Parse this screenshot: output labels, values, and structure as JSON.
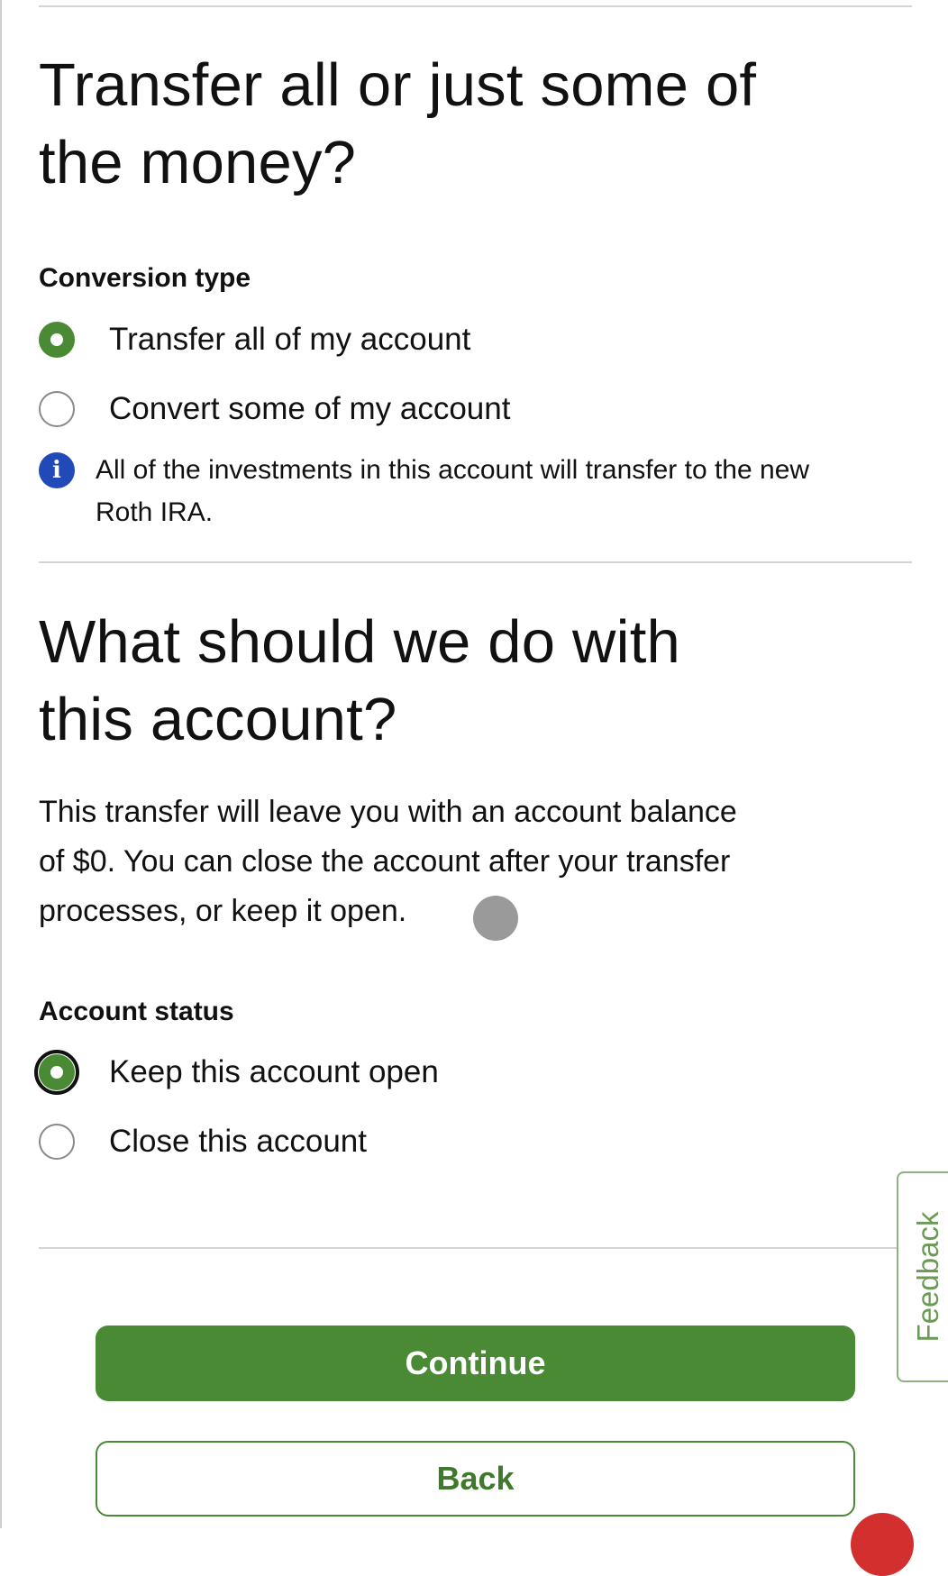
{
  "section1": {
    "title_line1": "Transfer all or just some of",
    "title_line2": "the money?",
    "label": "Conversion type",
    "options": [
      {
        "label": "Transfer all of my account",
        "selected": true
      },
      {
        "label": "Convert some of my account",
        "selected": false
      }
    ],
    "info_icon": "info-icon",
    "info_text_line1": "All of the investments in this account will transfer to the new",
    "info_text_line2": "Roth IRA."
  },
  "section2": {
    "title_line1": "What should we do with",
    "title_line2": "this account?",
    "paragraph_line1": "This transfer will leave you with an account balance",
    "paragraph_line2": "of $0. You can close the account after your transfer",
    "paragraph_line3": "processes, or keep it open.",
    "label": "Account status",
    "options": [
      {
        "label": "Keep this account open",
        "selected": true
      },
      {
        "label": "Close this account",
        "selected": false
      }
    ]
  },
  "buttons": {
    "continue": "Continue",
    "back": "Back"
  },
  "feedback_tab": "Feedback",
  "colors": {
    "accent": "#4a8a35",
    "info": "#2149b8",
    "divider": "#d4d4d4"
  }
}
